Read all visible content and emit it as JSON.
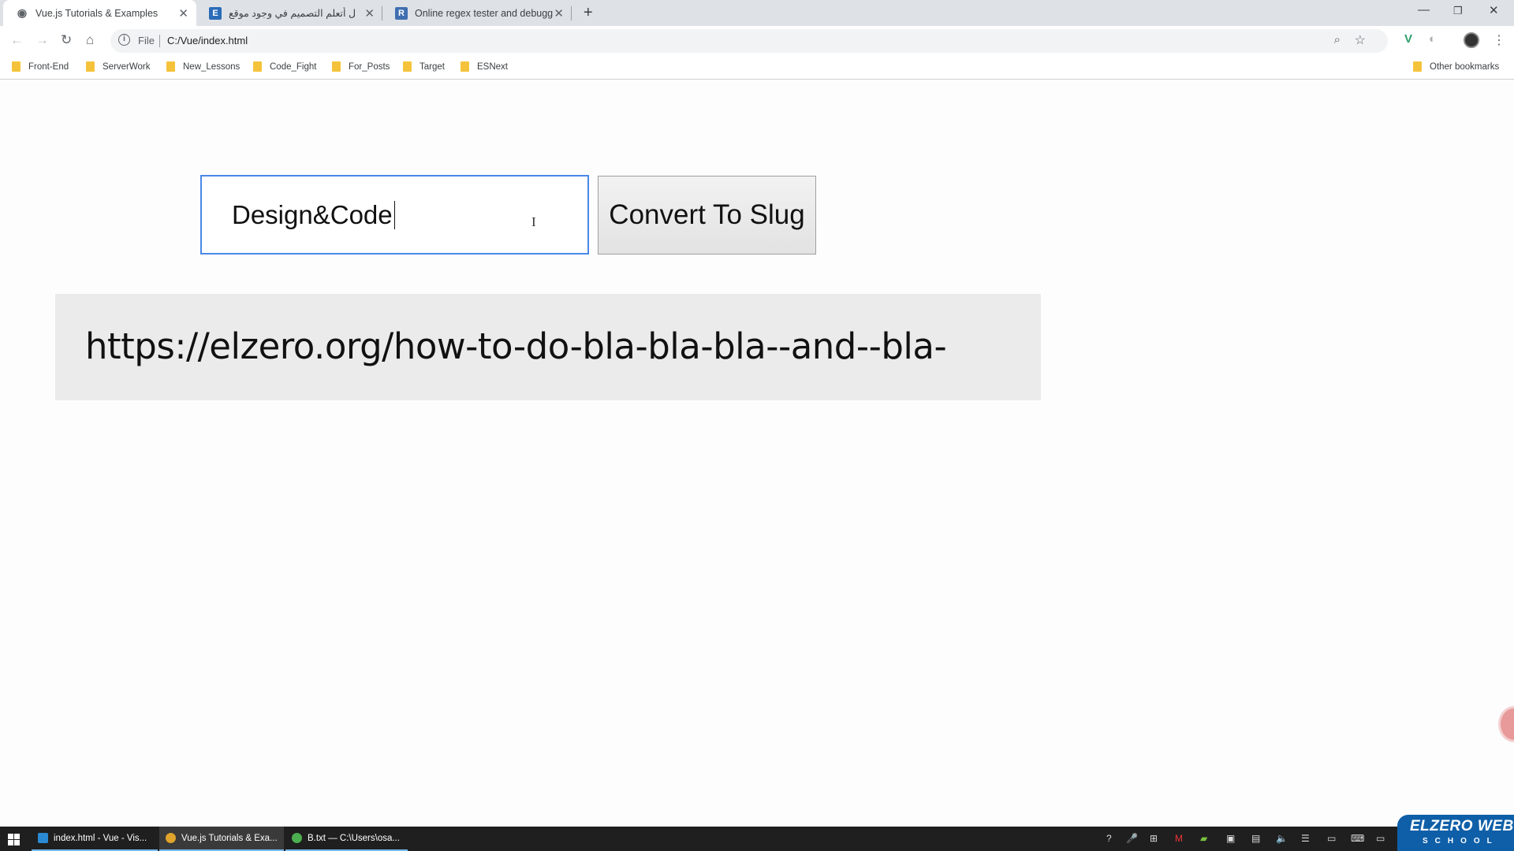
{
  "browser": {
    "tabs": [
      {
        "title": "Vue.js Tutorials & Examples",
        "favicon": "globe-icon",
        "active": true
      },
      {
        "title": "هل أتعلم التصميم في وجود موقع",
        "favicon": "E",
        "active": false
      },
      {
        "title": "Online regex tester and debugge",
        "favicon": "R",
        "active": false
      }
    ],
    "address": {
      "scheme_label": "File",
      "url": "C:/Vue/index.html"
    },
    "bookmarks": [
      "Front-End",
      "ServerWork",
      "New_Lessons",
      "Code_Fight",
      "For_Posts",
      "Target",
      "ESNext"
    ],
    "other_bookmarks": "Other bookmarks"
  },
  "page": {
    "input_value": "Design&Code",
    "button_label": "Convert To Slug",
    "result_url": "https://elzero.org/how-to-do-bla-bla-bla--and--bla-"
  },
  "taskbar": {
    "items": [
      {
        "label": "index.html - Vue - Vis...",
        "color": "#2a8ad4",
        "active": false
      },
      {
        "label": "Vue.js Tutorials & Exa...",
        "color": "#e0a32b",
        "active": true
      },
      {
        "label": "B.txt — C:\\Users\\osa...",
        "color": "#4caf50",
        "active": false
      }
    ],
    "tray_trail": "El"
  },
  "watermark": {
    "line1": "ELZERO WEB",
    "line2": "SCHOOL"
  },
  "colors": {
    "focus_border": "#4a88e6",
    "result_bg": "#ebebeb",
    "tabbar_bg": "#dee1e6",
    "taskbar_bg": "#1f1f1f"
  }
}
